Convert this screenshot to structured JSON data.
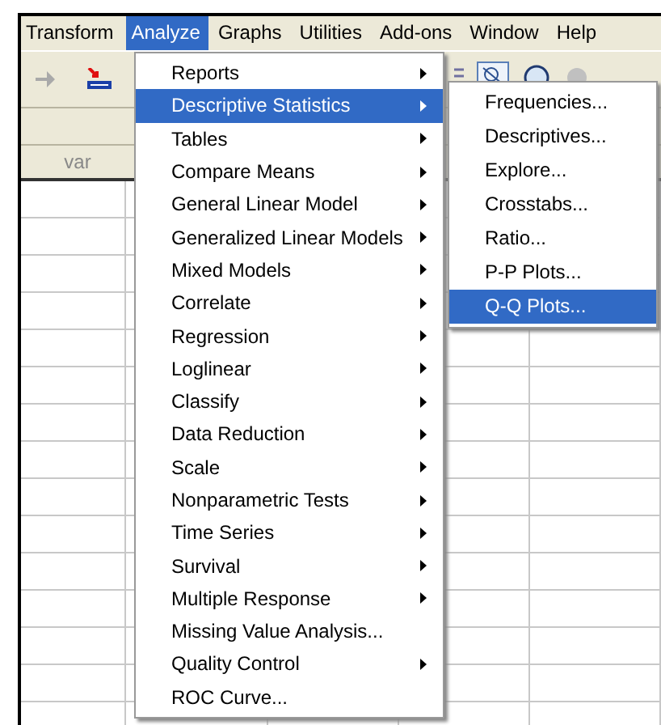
{
  "menu_bar": [
    {
      "label": "Transform",
      "selected": false
    },
    {
      "label": "Analyze",
      "selected": true
    },
    {
      "label": "Graphs",
      "selected": false
    },
    {
      "label": "Utilities",
      "selected": false
    },
    {
      "label": "Add-ons",
      "selected": false
    },
    {
      "label": "Window",
      "selected": false
    },
    {
      "label": "Help",
      "selected": false
    }
  ],
  "grid": {
    "column_header": "var"
  },
  "menu": [
    {
      "label": "Reports",
      "kind": "submenu",
      "selected": false
    },
    {
      "label": "Descriptive Statistics",
      "kind": "submenu",
      "selected": true
    },
    {
      "label": "Tables",
      "kind": "submenu",
      "selected": false
    },
    {
      "label": "Compare Means",
      "kind": "submenu",
      "selected": false
    },
    {
      "label": "General Linear Model",
      "kind": "submenu",
      "selected": false
    },
    {
      "label": "Generalized Linear Models",
      "kind": "submenu",
      "selected": false
    },
    {
      "label": "Mixed Models",
      "kind": "submenu",
      "selected": false
    },
    {
      "label": "Correlate",
      "kind": "submenu",
      "selected": false
    },
    {
      "label": "Regression",
      "kind": "submenu",
      "selected": false
    },
    {
      "label": "Loglinear",
      "kind": "submenu",
      "selected": false
    },
    {
      "label": "Classify",
      "kind": "submenu",
      "selected": false
    },
    {
      "label": "Data Reduction",
      "kind": "submenu",
      "selected": false
    },
    {
      "label": "Scale",
      "kind": "submenu",
      "selected": false
    },
    {
      "label": "Nonparametric Tests",
      "kind": "submenu",
      "selected": false
    },
    {
      "label": "Time Series",
      "kind": "submenu",
      "selected": false
    },
    {
      "label": "Survival",
      "kind": "submenu",
      "selected": false
    },
    {
      "label": "Multiple Response",
      "kind": "submenu",
      "selected": false
    },
    {
      "label": "Missing Value Analysis...",
      "kind": "command",
      "selected": false
    },
    {
      "label": "Quality Control",
      "kind": "submenu",
      "selected": false
    },
    {
      "label": "ROC Curve...",
      "kind": "command",
      "selected": false
    }
  ],
  "submenu": [
    {
      "label": "Frequencies...",
      "selected": false
    },
    {
      "label": "Descriptives...",
      "selected": false
    },
    {
      "label": "Explore...",
      "selected": false
    },
    {
      "label": "Crosstabs...",
      "selected": false
    },
    {
      "label": "Ratio...",
      "selected": false
    },
    {
      "label": "P-P Plots...",
      "selected": false
    },
    {
      "label": "Q-Q Plots...",
      "selected": true
    }
  ]
}
